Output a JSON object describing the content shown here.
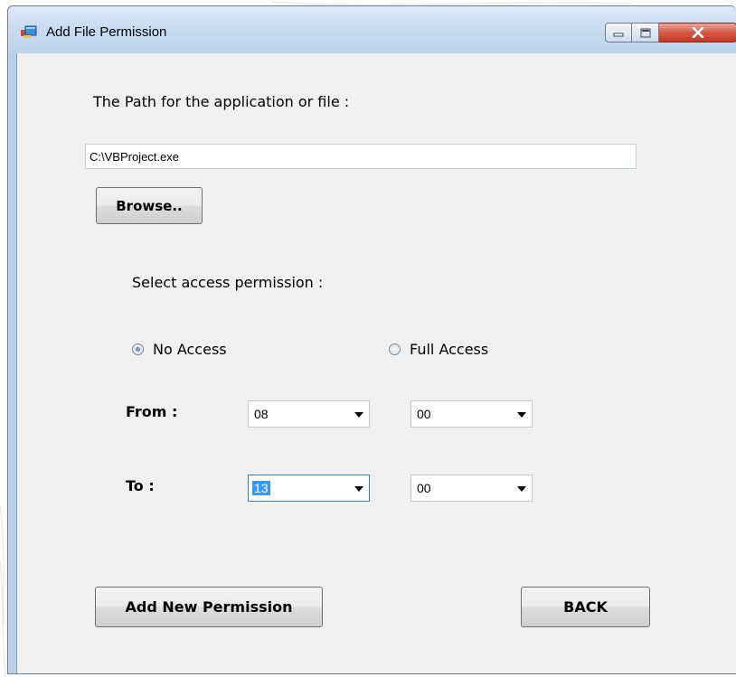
{
  "window": {
    "title": "Add File Permission",
    "accent": "#b9d1ea",
    "close_color": "#c23a24"
  },
  "form": {
    "path_label": "The Path for the application or file :",
    "path_value": "C:\\VBProject.exe",
    "browse_label": "Browse..",
    "permission_label": "Select access permission :",
    "radio_options": [
      {
        "label": "No Access",
        "checked": true
      },
      {
        "label": "Full Access",
        "checked": false
      }
    ],
    "from_label": "From :",
    "to_label": "To :",
    "from_hour": "08",
    "from_minute": "00",
    "to_hour": "13",
    "to_minute": "00",
    "add_label": "Add New Permission",
    "back_label": "BACK"
  },
  "icons": {
    "app": "app-icon",
    "minimize": "minimize-icon",
    "maximize": "maximize-icon",
    "close": "close-icon",
    "dropdown": "chevron-down-icon"
  }
}
